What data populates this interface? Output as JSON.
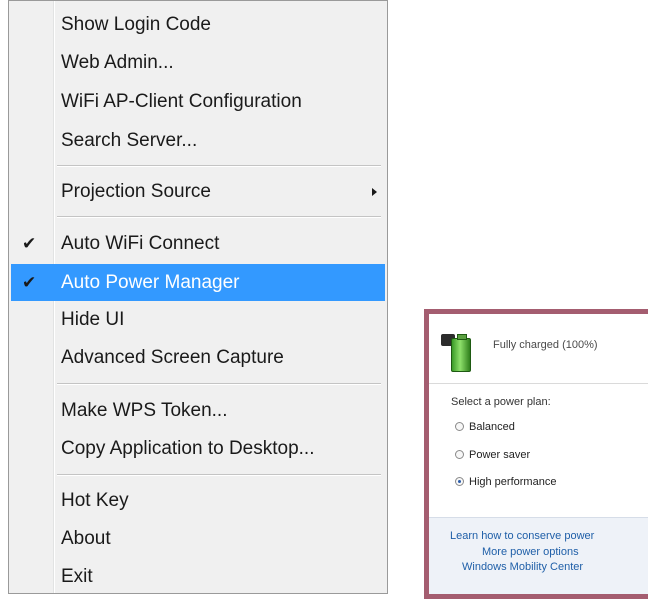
{
  "menu": {
    "items": [
      {
        "label": "Show Login Code"
      },
      {
        "label": "Web Admin..."
      },
      {
        "label": "WiFi AP-Client Configuration"
      },
      {
        "label": "Search Server..."
      },
      {
        "label": "Projection Source"
      },
      {
        "label": "Auto WiFi Connect",
        "checked": true
      },
      {
        "label": "Auto Power Manager",
        "checked": true
      },
      {
        "label": "Hide UI"
      },
      {
        "label": "Advanced Screen Capture"
      },
      {
        "label": "Make WPS Token..."
      },
      {
        "label": "Copy Application to Desktop..."
      },
      {
        "label": "Hot Key"
      },
      {
        "label": "About"
      },
      {
        "label": "Exit"
      }
    ],
    "check_glyph": "✔",
    "highlight_color": "#3399ff"
  },
  "power": {
    "status": "Fully charged (100%)",
    "select_label": "Select a power plan:",
    "plans": [
      {
        "label": "Balanced",
        "selected": false
      },
      {
        "label": "Power saver",
        "selected": false
      },
      {
        "label": "High performance",
        "selected": true
      }
    ],
    "links": [
      "Learn how to conserve power",
      "More power options",
      "Windows Mobility Center"
    ],
    "border_color": "#a45d70"
  }
}
